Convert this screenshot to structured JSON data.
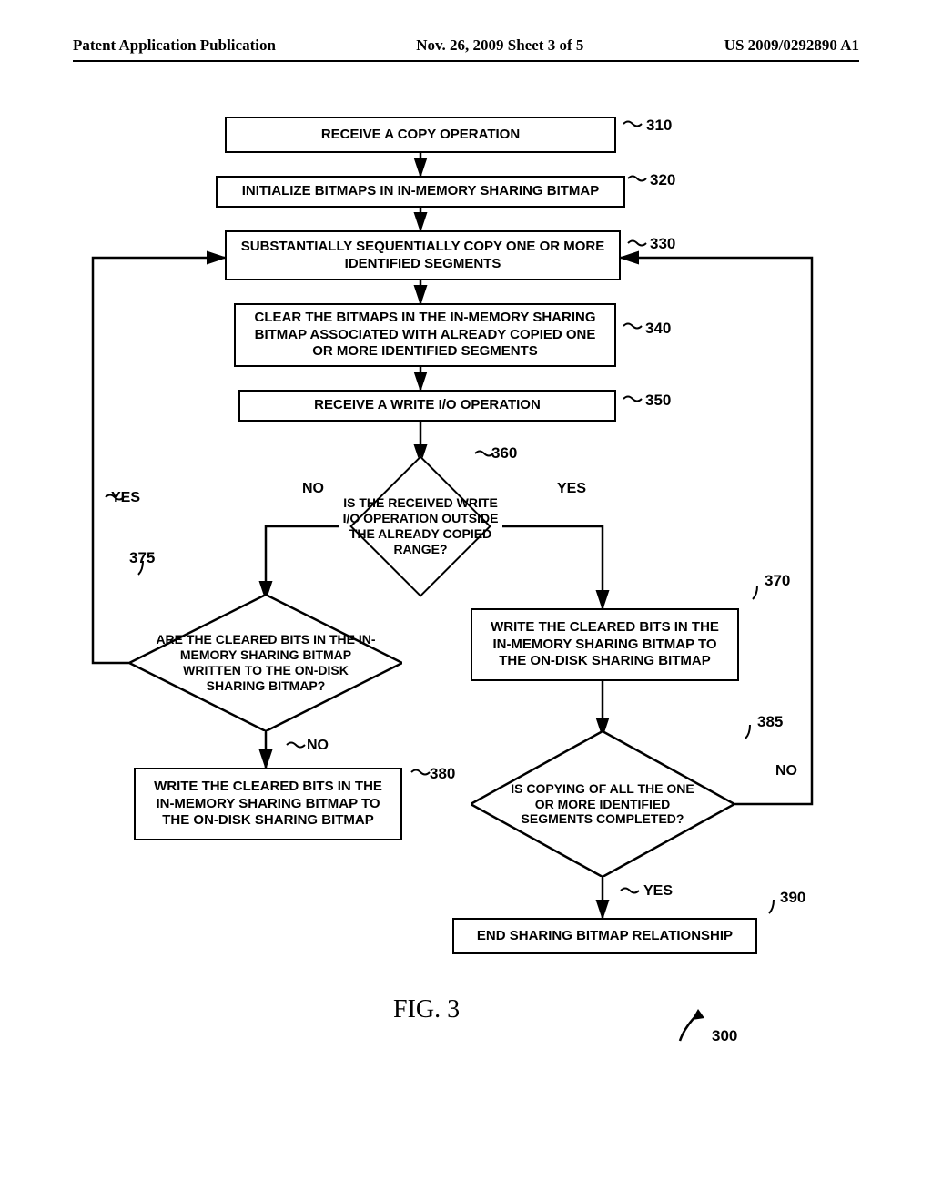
{
  "header": {
    "left": "Patent Application Publication",
    "center": "Nov. 26, 2009  Sheet 3 of 5",
    "right": "US 2009/0292890 A1"
  },
  "boxes": {
    "b310": "RECEIVE A COPY OPERATION",
    "b320": "INITIALIZE BITMAPS IN IN-MEMORY SHARING BITMAP",
    "b330": "SUBSTANTIALLY SEQUENTIALLY COPY ONE OR MORE IDENTIFIED SEGMENTS",
    "b340": "CLEAR THE BITMAPS IN THE IN-MEMORY SHARING BITMAP ASSOCIATED WITH ALREADY COPIED ONE OR MORE IDENTIFIED SEGMENTS",
    "b350": "RECEIVE A WRITE I/O OPERATION",
    "d360": "IS THE RECEIVED WRITE I/O OPERATION OUTSIDE THE ALREADY COPIED RANGE?",
    "b370": "WRITE THE CLEARED BITS IN THE IN-MEMORY SHARING BITMAP TO THE ON-DISK SHARING BITMAP",
    "d375": "ARE THE CLEARED BITS IN THE IN-MEMORY SHARING BITMAP WRITTEN TO THE ON-DISK SHARING BITMAP?",
    "b380": "WRITE THE CLEARED BITS IN THE IN-MEMORY SHARING BITMAP TO THE ON-DISK SHARING BITMAP",
    "d385": "IS COPYING OF ALL THE ONE OR MORE IDENTIFIED SEGMENTS COMPLETED?",
    "b390": "END SHARING BITMAP RELATIONSHIP"
  },
  "refs": {
    "r310": "310",
    "r320": "320",
    "r330": "330",
    "r340": "340",
    "r350": "350",
    "r360": "360",
    "r370": "370",
    "r375": "375",
    "r380": "380",
    "r385": "385",
    "r390": "390",
    "r300": "300"
  },
  "labels": {
    "no360": "NO",
    "yes360": "YES",
    "yes375": "YES",
    "no375": "NO",
    "no385": "NO",
    "yes385": "YES"
  },
  "figure": "FIG. 3"
}
